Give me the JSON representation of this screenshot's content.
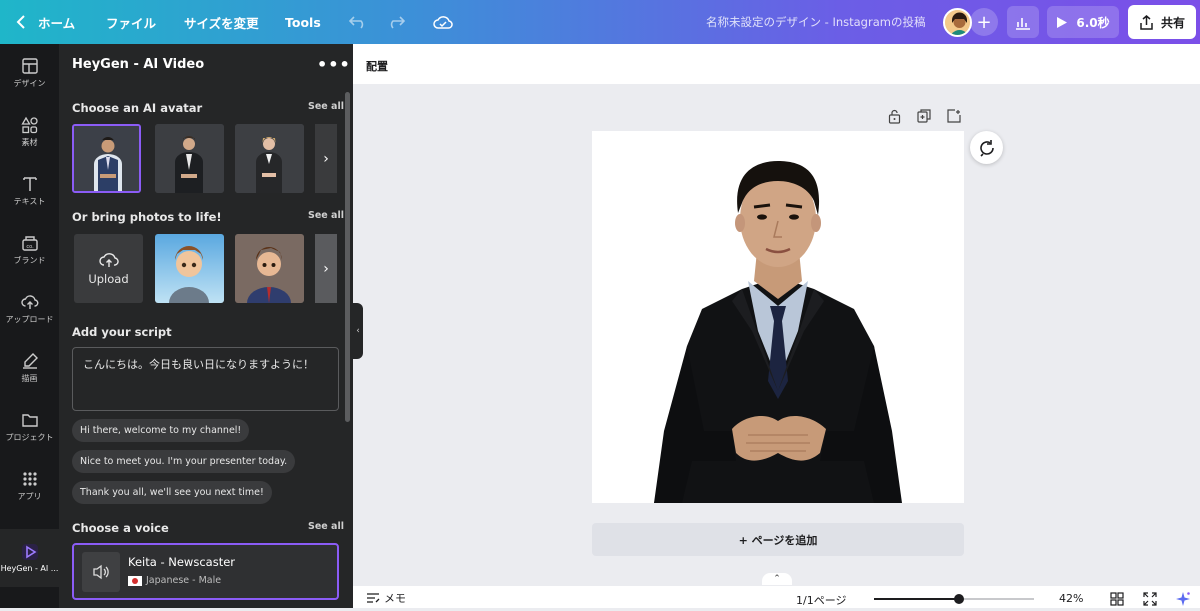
{
  "topbar": {
    "home_label": "ホーム",
    "file_label": "ファイル",
    "resize_label": "サイズを変更",
    "tools_label": "Tools",
    "doc_title": "名称未設定のデザイン - Instagramの投稿",
    "play_label": "6.0秒",
    "share_label": "共有"
  },
  "rail": {
    "items": [
      {
        "label": "デザイン",
        "icon": "layout-icon"
      },
      {
        "label": "素材",
        "icon": "elements-icon"
      },
      {
        "label": "テキスト",
        "icon": "text-icon"
      },
      {
        "label": "ブランド",
        "icon": "brand-icon"
      },
      {
        "label": "アップロード",
        "icon": "upload-icon"
      },
      {
        "label": "描画",
        "icon": "draw-icon"
      },
      {
        "label": "プロジェクト",
        "icon": "folder-icon"
      },
      {
        "label": "アプリ",
        "icon": "apps-icon"
      },
      {
        "label": "HeyGen - AI ...",
        "icon": "heygen-icon"
      }
    ]
  },
  "panel": {
    "title": "HeyGen - AI Video",
    "avatar_section": "Choose an AI avatar",
    "photos_section": "Or bring photos to life!",
    "see_all": "See all",
    "upload_label": "Upload",
    "script_section": "Add your script",
    "script_text": "こんにちは。今日も良い日になりますように！",
    "suggestions": [
      "Hi there, welcome to my channel!",
      "Nice to meet you. I'm your presenter today.",
      "Thank you all, we'll see you next time!"
    ],
    "voice_section": "Choose a voice",
    "voice_name": "Keita - Newscaster",
    "voice_detail": "Japanese - Male"
  },
  "canvas": {
    "arrange_label": "配置",
    "add_page_label": "+ ページを追加"
  },
  "footer": {
    "memo_label": "メモ",
    "pages_label": "1/1ページ",
    "zoom_label": "42%",
    "zoom_level": 0.42
  },
  "colors": {
    "accent": "#8b5cf6",
    "panel_bg": "#252627",
    "rail_bg": "#18191b"
  }
}
